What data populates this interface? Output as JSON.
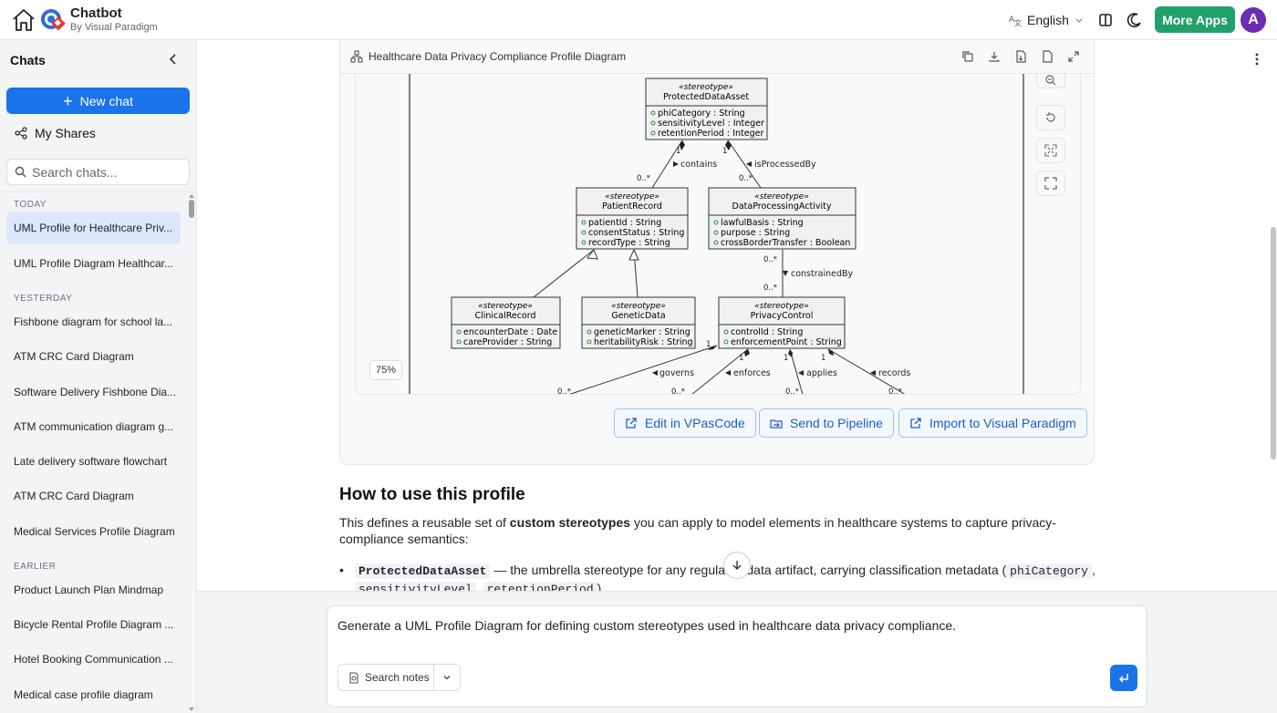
{
  "app": {
    "name": "Chatbot",
    "subtitle": "By Visual Paradigm",
    "language": "English",
    "more_apps_label": "More Apps",
    "avatar_initial": "A"
  },
  "sidebar": {
    "title": "Chats",
    "new_chat_label": "New chat",
    "my_shares_label": "My Shares",
    "search_placeholder": "Search chats...",
    "groups": [
      {
        "label": "TODAY",
        "items": [
          "UML Profile for Healthcare Priv...",
          "UML Profile Diagram Healthcar..."
        ]
      },
      {
        "label": "YESTERDAY",
        "items": [
          "Fishbone diagram for school la...",
          "ATM CRC Card Diagram",
          "Software Delivery Fishbone Dia...",
          "ATM communication diagram g...",
          "Late delivery software flowchart",
          "ATM CRC Card Diagram",
          "Medical Services Profile Diagram"
        ]
      },
      {
        "label": "EARLIER",
        "items": [
          "Product Launch Plan Mindmap",
          "Bicycle Rental Profile Diagram ...",
          "Hotel Booking Communication ...",
          "Medical case profile diagram"
        ]
      }
    ]
  },
  "diagram": {
    "title": "Healthcare Data Privacy Compliance Profile Diagram",
    "zoom": "75%",
    "stereotype_label": "«stereotype»",
    "classes": {
      "protected": {
        "name": "ProtectedDataAsset",
        "attrs": [
          "phiCategory : String",
          "sensitivityLevel : Integer",
          "retentionPeriod : Integer"
        ]
      },
      "patient": {
        "name": "PatientRecord",
        "attrs": [
          "patientId : String",
          "consentStatus : String",
          "recordType : String"
        ]
      },
      "processing": {
        "name": "DataProcessingActivity",
        "attrs": [
          "lawfulBasis : String",
          "purpose : String",
          "crossBorderTransfer : Boolean"
        ]
      },
      "clinical": {
        "name": "ClinicalRecord",
        "attrs": [
          "encounterDate : Date",
          "careProvider : String"
        ]
      },
      "genetic": {
        "name": "GeneticData",
        "attrs": [
          "geneticMarker : String",
          "heritabilityRisk : String"
        ]
      },
      "privacy": {
        "name": "PrivacyControl",
        "attrs": [
          "controlId : String",
          "enforcementPoint : String"
        ]
      }
    },
    "assoc_labels": {
      "contains": "contains",
      "isProcessedBy": "isProcessedBy",
      "constrainedBy": "constrainedBy",
      "governs": "governs",
      "enforces": "enforces",
      "applies": "applies",
      "records": "records"
    },
    "multiplicities": {
      "one": "1",
      "many": "0..*"
    },
    "actions": {
      "edit": "Edit in VPasCode",
      "pipeline": "Send to Pipeline",
      "import": "Import to Visual Paradigm"
    }
  },
  "content": {
    "heading": "How to use this profile",
    "para_before": "This defines a reusable set of ",
    "para_bold": "custom stereotypes",
    "para_after": " you can apply to model elements in healthcare systems to capture privacy-compliance semantics:",
    "bullet_code": "ProtectedDataAsset",
    "bullet_text": " — the umbrella stereotype for any regulated data artifact, carrying classification metadata (",
    "bullet_code2": "phiCategory",
    "bullet_sep": ",",
    "bullet_code3": "sensitivityLevel",
    "bullet_code4": "retentionPeriod",
    "bullet_end": ")."
  },
  "composer": {
    "prompt": "Generate a UML Profile Diagram for defining custom stereotypes used in healthcare data privacy compliance.",
    "search_notes_label": "Search notes"
  },
  "colors": {
    "primary": "#1a73e8",
    "more_apps": "#22a06b",
    "avatar": "#6b2bb3",
    "class_fill": "#f1f1f1"
  }
}
